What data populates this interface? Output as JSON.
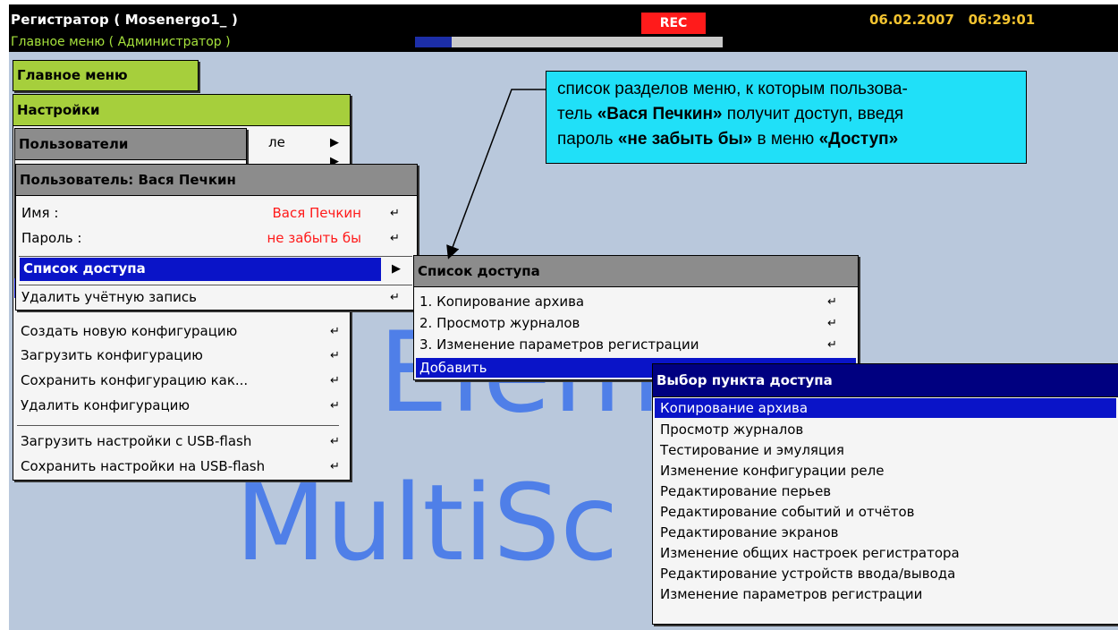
{
  "header": {
    "app_title": "Регистратор ( Mosenergo1_ )",
    "subtitle": "Главное меню ( Администратор )",
    "rec": "REC",
    "date": "06.02.2007",
    "time": "06:29:01",
    "progress": 0.12
  },
  "watermark": {
    "line1": "Elem",
    "line2": "MultiSc"
  },
  "main_menu": {
    "title": "Главное меню"
  },
  "settings_menu": {
    "title": "Настройки",
    "partial_item": "ле",
    "items": [
      "Создать новую конфигурацию",
      "Загрузить конфигурацию",
      "Сохранить конфигурацию как...",
      "Удалить конфигурацию",
      "Загрузить настройки с USB-flash",
      "Сохранить настройки на USB-flash"
    ]
  },
  "users_menu": {
    "title": "Пользователи"
  },
  "user_panel": {
    "title": "Пользователь: Вася Печкин",
    "name_label": "Имя :",
    "name_value": "Вася Печкин",
    "password_label": "Пароль :",
    "password_value": "не забыть бы",
    "access_list": "Список доступа",
    "delete": "Удалить учётную запись"
  },
  "access_list": {
    "title": "Список доступа",
    "items": [
      "1. Копирование архива",
      "2. Просмотр журналов",
      "3. Изменение параметров регистрации"
    ],
    "add": "Добавить"
  },
  "choose_access": {
    "title": "Выбор пункта доступа",
    "items": [
      "Копирование архива",
      "Просмотр журналов",
      "Тестирование и эмуляция",
      "Изменение конфигурации реле",
      "Редактирование перьев",
      "Редактирование событий и отчётов",
      "Редактирование экранов",
      "Изменение общих настроек регистратора",
      "Редактирование устройств ввода/вывода",
      "Изменение параметров регистрации"
    ]
  },
  "callout": {
    "t1": "список разделов меню, к которым пользова-",
    "t2": "тель ",
    "t3": "«Вася Печкин»",
    "t4": " получит доступ, введя",
    "t5": "пароль ",
    "t6": "«не забыть бы»",
    "t7": " в меню ",
    "t8": "«Доступ»"
  }
}
